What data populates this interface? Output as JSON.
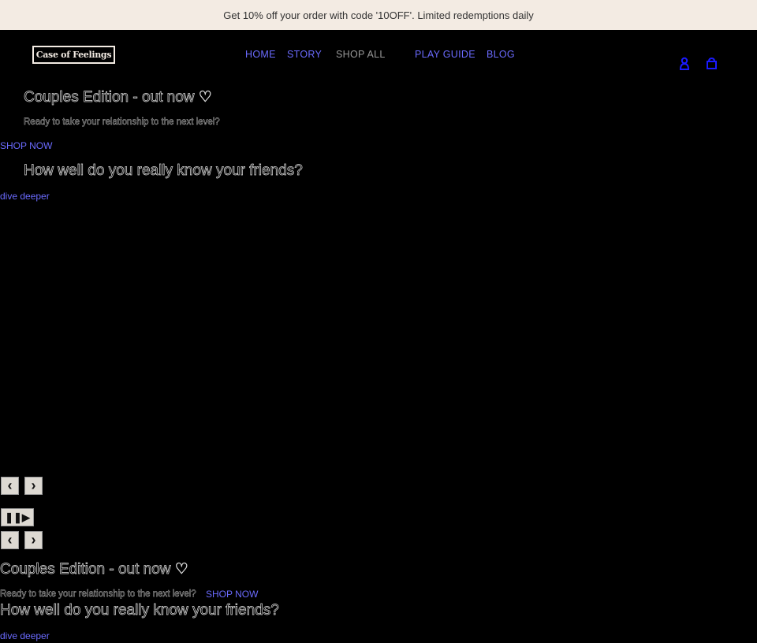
{
  "announcement": "Get 10% off your order with code '10OFF'. Limited redemptions daily",
  "logo": "Case of Feelings",
  "nav": [
    "HOME",
    "STORY",
    "SHOP ALL",
    "PLAY GUIDE",
    "BLOG"
  ],
  "icons": {
    "account": "account-icon",
    "cart": "cart-icon"
  },
  "slides": [
    {
      "heading": "Couples Edition - out now ♡",
      "text": "Ready to take your relationship to the next level?",
      "link": "SHOP NOW"
    },
    {
      "heading": "How well do you really know your friends?",
      "link": "dive deeper"
    }
  ],
  "controls": {
    "prev": "‹",
    "next": "›",
    "pause_play": "❚❚▶"
  },
  "colors": {
    "accent": "#6b6bff",
    "banner": "#f3ebe3"
  }
}
